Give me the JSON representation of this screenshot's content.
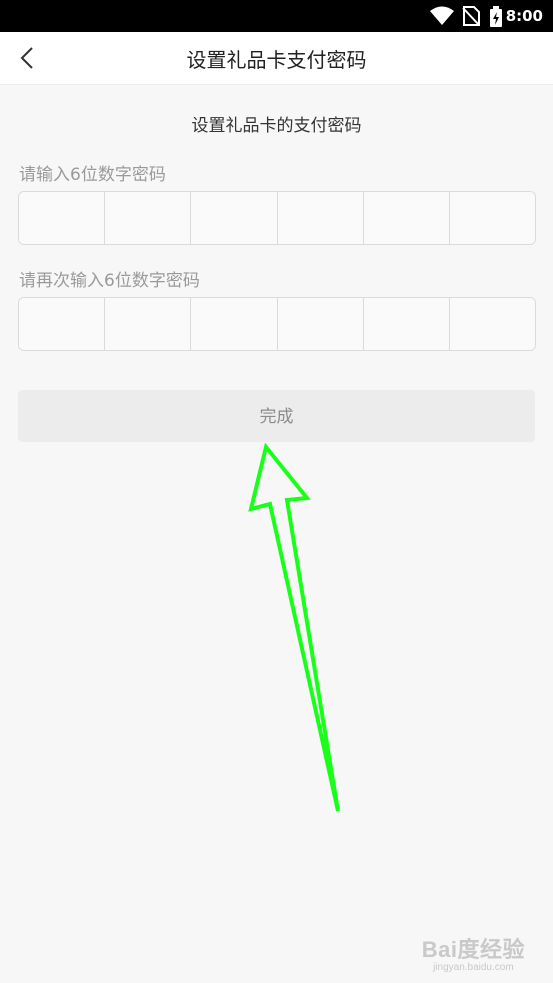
{
  "status_bar": {
    "time": "8:00",
    "icons": [
      "wifi-icon",
      "no-sim-icon",
      "battery-charging-icon"
    ]
  },
  "header": {
    "back_icon": "chevron-left-icon",
    "title": "设置礼品卡支付密码"
  },
  "form": {
    "subtitle": "设置礼品卡的支付密码",
    "pin_label": "请输入6位数字密码",
    "confirm_label": "请再次输入6位数字密码",
    "pin_digits": 6,
    "submit_label": "完成"
  },
  "annotation": {
    "arrow_color": "#1aff1a"
  },
  "watermark": {
    "logo": "Bai度经验",
    "url": "jingyan.baidu.com"
  }
}
